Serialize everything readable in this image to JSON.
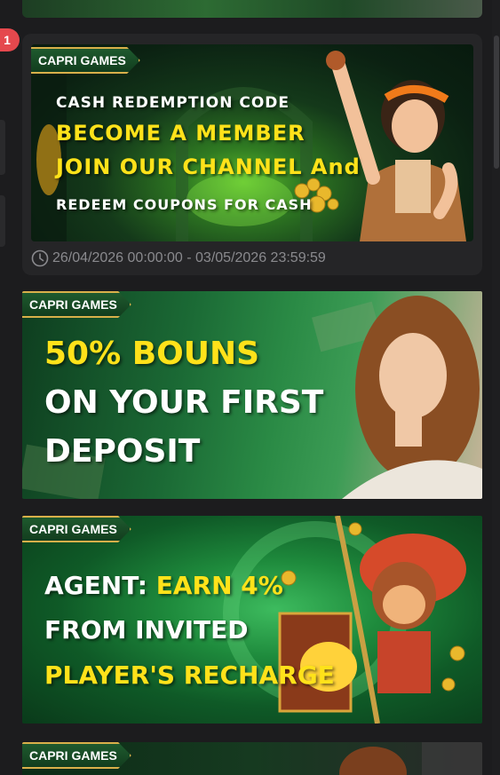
{
  "notification": {
    "count": "1"
  },
  "cards": [
    {
      "brand": "CAPRI GAMES",
      "lines": [
        "CASH REDEMPTION CODE",
        "BECOME A MEMBER",
        "JOIN OUR CHANNEL And",
        "REDEEM COUPONS FOR CASH"
      ],
      "time_range": "26/04/2026 00:00:00 - 03/05/2026 23:59:59",
      "icon": "clock-icon"
    },
    {
      "brand": "CAPRI GAMES",
      "lines": [
        "50% BOUNS",
        "ON YOUR FIRST",
        "DEPOSIT"
      ]
    },
    {
      "brand": "CAPRI GAMES",
      "lines": [
        "AGENT: ",
        "EARN 4%",
        "FROM INVITED",
        "PLAYER'S RECHARGE"
      ]
    },
    {
      "brand": "CAPRI GAMES"
    }
  ],
  "colors": {
    "accent_yellow": "#ffe21a",
    "badge_red": "#e5484d",
    "tag_gold": "#d9b04a"
  }
}
